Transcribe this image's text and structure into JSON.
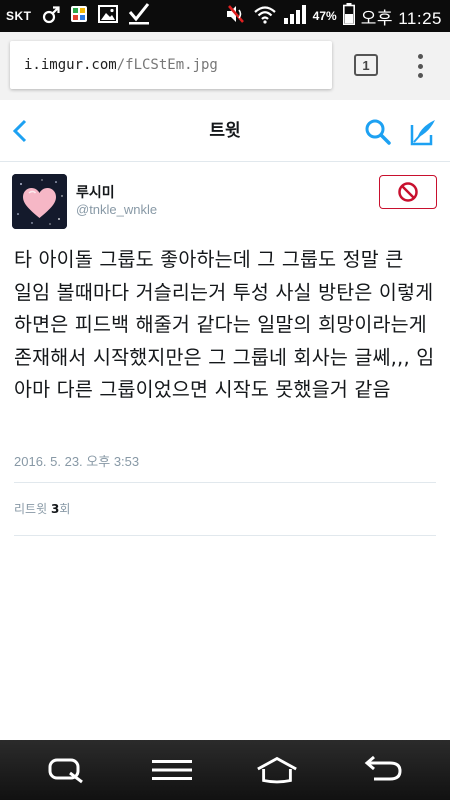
{
  "status_bar": {
    "carrier": "SKT",
    "battery_percent": "47%",
    "time": "오후 11:25",
    "icons": [
      "male-symbol-icon",
      "store-icon",
      "gallery-icon",
      "download-check-icon",
      "mute-icon",
      "wifi-icon",
      "signal-icon",
      "battery-icon"
    ]
  },
  "browser": {
    "url_host": "i.imgur.com",
    "url_path": "/fLCStEm.jpg",
    "tab_count": "1"
  },
  "header": {
    "title": "트윗"
  },
  "tweet": {
    "display_name": "루시미",
    "handle": "@tnkle_wnkle",
    "text": "타 아이돌 그룹도 좋아하는데 그 그룹도 정말 큰 일임 볼때마다 거슬리는거 투성 사실 방탄은 이렇게 하면은 피드백 해줄거 같다는 일말의 희망이라는게 존재해서 시작했지만은 그 그룹네 회사는 글쎄,,, 임 아마 다른 그룹이었으면 시작도 못했을거 같음",
    "timestamp": "2016. 5. 23. 오후 3:53",
    "retweet_label": "리트윗",
    "retweet_count": "3",
    "retweet_unit": "회"
  },
  "colors": {
    "twitter_blue": "#1da1f2",
    "block_red": "#c8102e",
    "status_bar_bg": "#0c0c0c",
    "nav_bar_bg": "#111111"
  }
}
